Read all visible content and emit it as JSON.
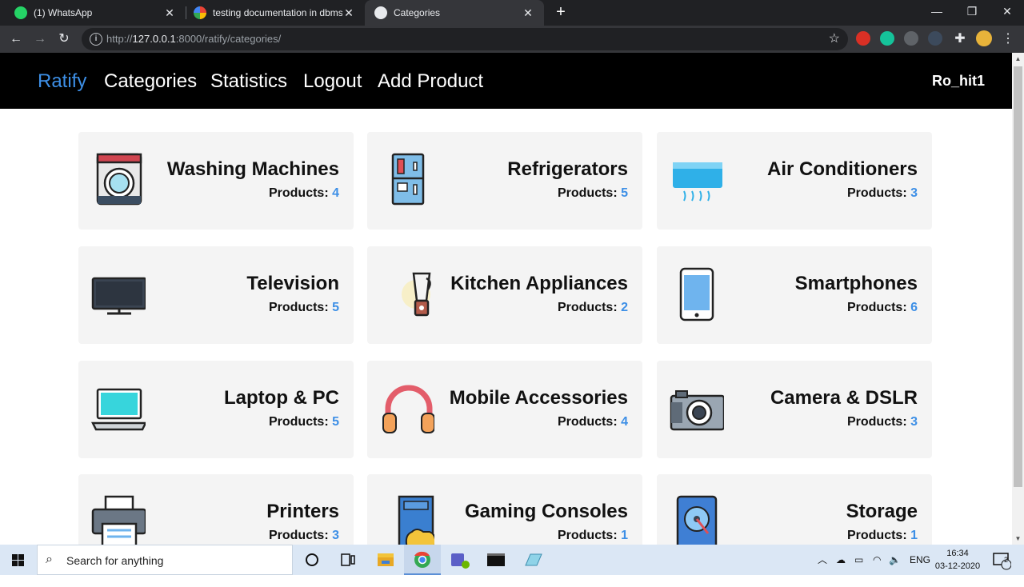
{
  "browser": {
    "tabs": [
      {
        "title": "(1) WhatsApp",
        "close": "✕"
      },
      {
        "title": "testing documentation in dbms -",
        "close": "✕"
      },
      {
        "title": "Categories",
        "close": "✕"
      }
    ],
    "new_tab": "+",
    "window": {
      "minimize": "—",
      "restore": "❐",
      "close": "✕"
    },
    "url_prefix": "http://",
    "url_host": "127.0.0.1",
    "url_rest": ":8000/ratify/categories/"
  },
  "navbar": {
    "brand": "Ratify",
    "links": [
      "Categories",
      "Statistics",
      "Logout",
      "Add Product"
    ],
    "user": "Ro_hit1"
  },
  "products_label": "Products:",
  "categories": [
    {
      "name": "Washing Machines",
      "count": "4",
      "icon": "washing-machine-icon"
    },
    {
      "name": "Refrigerators",
      "count": "5",
      "icon": "refrigerator-icon"
    },
    {
      "name": "Air Conditioners",
      "count": "3",
      "icon": "air-conditioner-icon"
    },
    {
      "name": "Television",
      "count": "5",
      "icon": "television-icon"
    },
    {
      "name": "Kitchen Appliances",
      "count": "2",
      "icon": "blender-icon"
    },
    {
      "name": "Smartphones",
      "count": "6",
      "icon": "smartphone-icon"
    },
    {
      "name": "Laptop & PC",
      "count": "5",
      "icon": "laptop-icon"
    },
    {
      "name": "Mobile Accessories",
      "count": "4",
      "icon": "headphones-icon"
    },
    {
      "name": "Camera & DSLR",
      "count": "3",
      "icon": "camera-icon"
    },
    {
      "name": "Printers",
      "count": "3",
      "icon": "printer-icon"
    },
    {
      "name": "Gaming Consoles",
      "count": "1",
      "icon": "gaming-console-icon"
    },
    {
      "name": "Storage",
      "count": "1",
      "icon": "hard-drive-icon"
    }
  ],
  "taskbar": {
    "search_placeholder": "Search for anything",
    "language": "ENG",
    "time": "16:34",
    "date": "03-12-2020",
    "notifications": "2"
  },
  "colors": {
    "accent": "#3d8fe6",
    "navbar": "#000000",
    "card": "#f4f4f4"
  }
}
